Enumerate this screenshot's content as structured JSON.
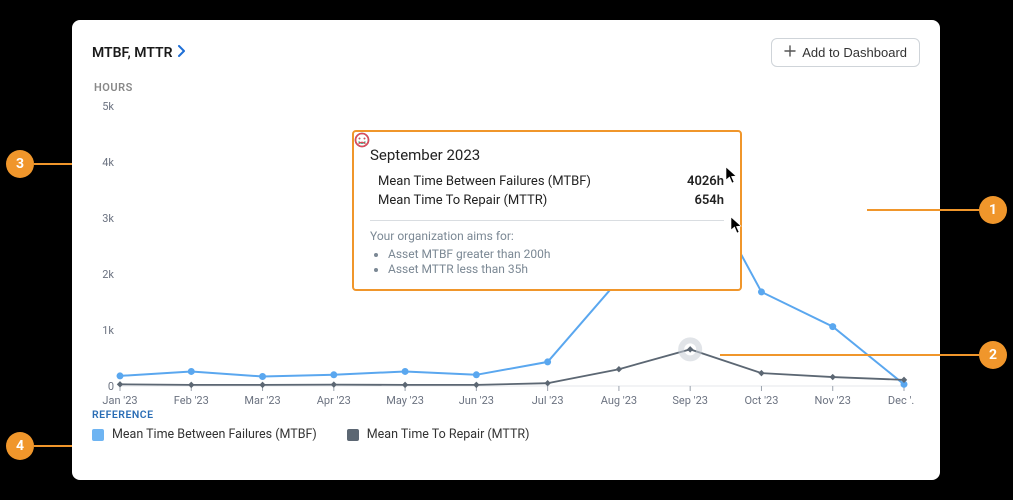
{
  "header": {
    "title": "MTBF, MTTR",
    "add_button": "Add to Dashboard"
  },
  "tooltip": {
    "period": "September 2023",
    "rows": [
      {
        "label": "Mean Time Between Failures (MTBF)",
        "value": "4026h",
        "mood": "good"
      },
      {
        "label": "Mean Time To Repair (MTTR)",
        "value": "654h",
        "mood": "bad"
      }
    ],
    "goal_heading": "Your organization aims for:",
    "goals": [
      "Asset MTBF greater than 200h",
      "Asset MTTR less than 35h"
    ]
  },
  "legend": {
    "heading": "REFERENCE",
    "items": [
      "Mean Time Between Failures (MTBF)",
      "Mean Time To Repair (MTTR)"
    ]
  },
  "annotations": {
    "a1": "1",
    "a2": "2",
    "a3": "3",
    "a4": "4"
  },
  "chart_data": {
    "type": "line",
    "ylabel": "HOURS",
    "ylim": [
      0,
      5000
    ],
    "yticks": [
      "0",
      "1k",
      "2k",
      "3k",
      "4k",
      "5k"
    ],
    "categories": [
      "Jan '23",
      "Feb '23",
      "Mar '23",
      "Apr '23",
      "May '23",
      "Jun '23",
      "Jul '23",
      "Aug '23",
      "Sep '23",
      "Oct '23",
      "Nov '23",
      "Dec '..."
    ],
    "series": [
      {
        "name": "Mean Time Between Failures (MTBF)",
        "key": "mtbf",
        "color": "#5aa7ef",
        "values": [
          180,
          260,
          170,
          200,
          260,
          200,
          430,
          1900,
          4026,
          1680,
          1060,
          30
        ]
      },
      {
        "name": "Mean Time To Repair (MTTR)",
        "key": "mttr",
        "color": "#5c6773",
        "values": [
          30,
          20,
          20,
          25,
          20,
          20,
          50,
          300,
          654,
          230,
          160,
          110
        ]
      }
    ],
    "highlight_index": 8
  }
}
